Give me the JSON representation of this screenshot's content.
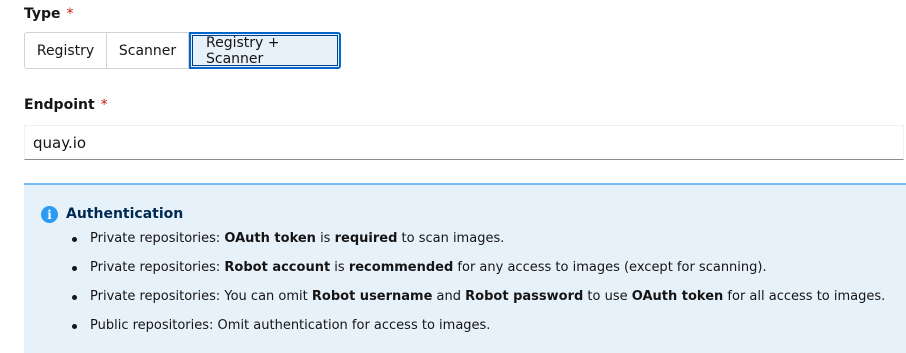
{
  "type_field": {
    "label": "Type",
    "required_mark": "*",
    "options": [
      "Registry",
      "Scanner",
      "Registry + Scanner"
    ],
    "selected": "Registry + Scanner"
  },
  "endpoint_field": {
    "label": "Endpoint",
    "required_mark": "*",
    "value": "quay.io"
  },
  "alert": {
    "icon": "info-icon",
    "title": "Authentication",
    "items": [
      [
        {
          "t": "Private repositories: "
        },
        {
          "t": "OAuth token",
          "b": true
        },
        {
          "t": " is "
        },
        {
          "t": "required",
          "b": true
        },
        {
          "t": " to scan images."
        }
      ],
      [
        {
          "t": "Private repositories: "
        },
        {
          "t": "Robot account",
          "b": true
        },
        {
          "t": " is "
        },
        {
          "t": "recommended",
          "b": true
        },
        {
          "t": " for any access to images (except for scanning)."
        }
      ],
      [
        {
          "t": "Private repositories: You can omit "
        },
        {
          "t": "Robot username",
          "b": true
        },
        {
          "t": " and "
        },
        {
          "t": "Robot password",
          "b": true
        },
        {
          "t": " to use "
        },
        {
          "t": "OAuth token",
          "b": true
        },
        {
          "t": " for all access to images."
        }
      ],
      [
        {
          "t": "Public repositories: Omit authentication for access to images."
        }
      ]
    ]
  },
  "colors": {
    "accent": "#0066cc",
    "required": "#c9190b",
    "alert_bg": "#e7f1fa",
    "alert_icon": "#2b9af3"
  }
}
